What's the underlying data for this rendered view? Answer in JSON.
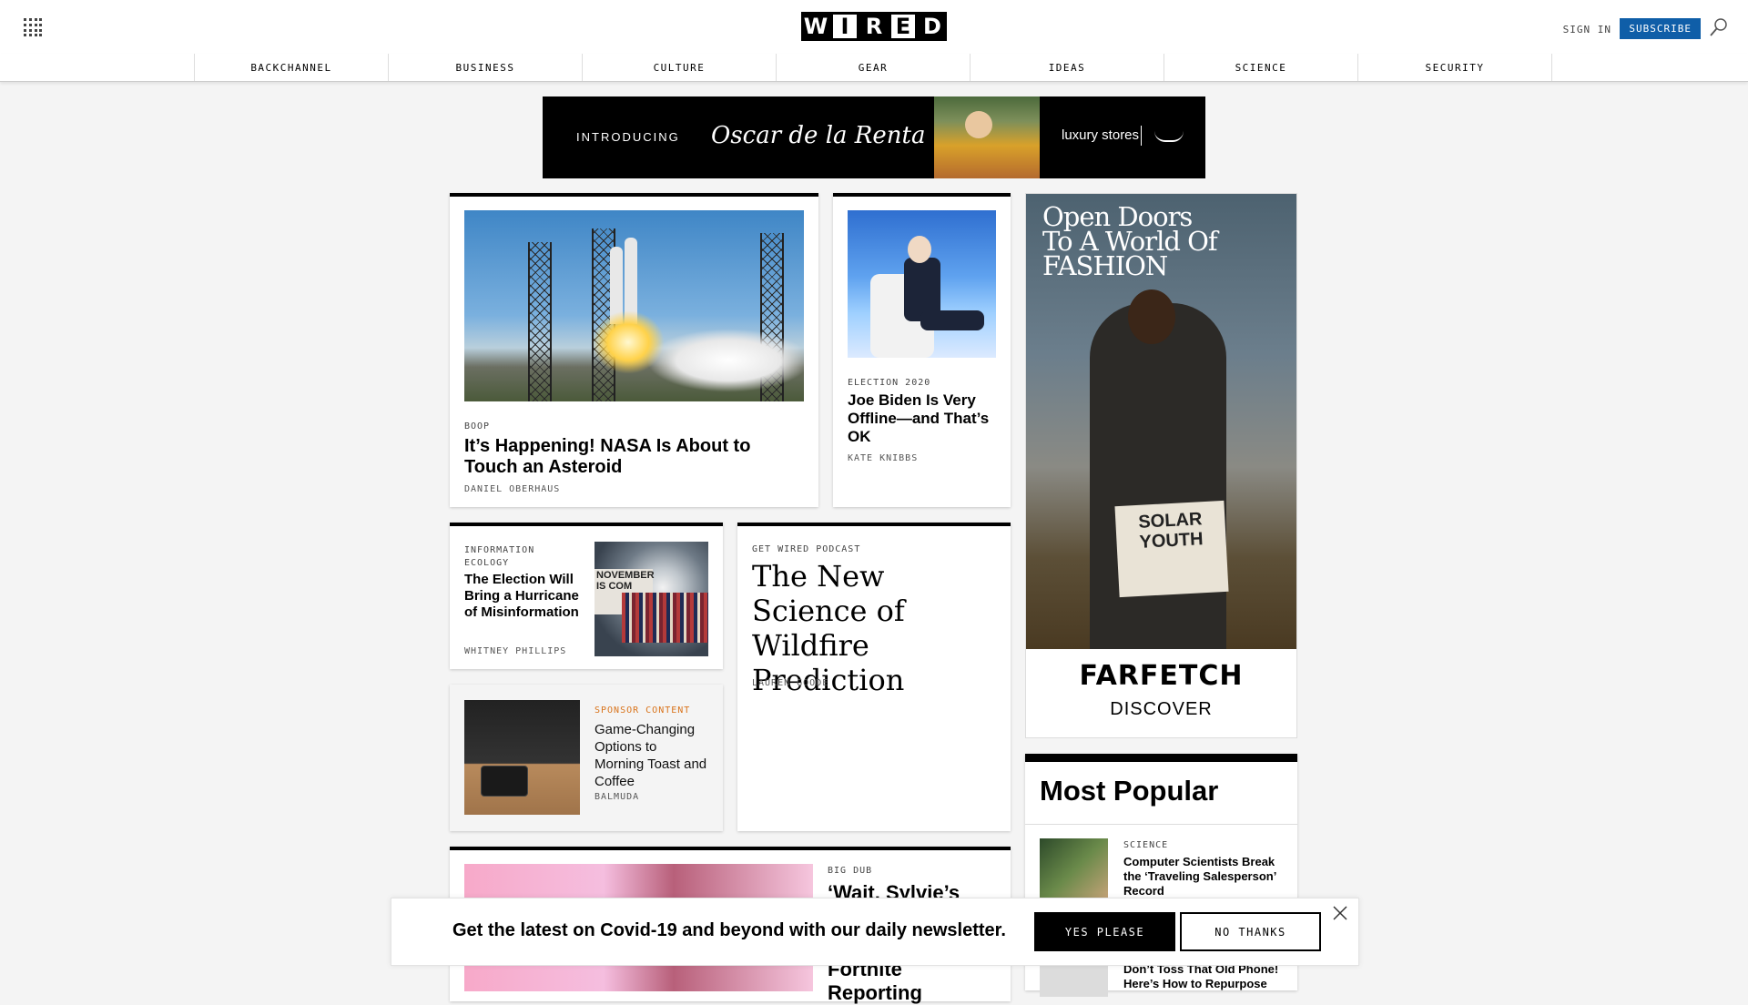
{
  "header": {
    "logo_letters": [
      "W",
      "I",
      "R",
      "E",
      "D"
    ],
    "sign_in": "SIGN IN",
    "subscribe": "SUBSCRIBE"
  },
  "nav": {
    "items": [
      "BACKCHANNEL",
      "BUSINESS",
      "CULTURE",
      "GEAR",
      "IDEAS",
      "SCIENCE",
      "SECURITY"
    ]
  },
  "ad_banner": {
    "intro": "INTRODUCING",
    "brand": "Oscar de la Renta",
    "store": "luxury stores"
  },
  "stories": {
    "nasa": {
      "kicker": "BOOP",
      "headline": "It’s Happening! NASA Is About to Touch an Asteroid",
      "byline": "DANIEL OBERHAUS"
    },
    "biden": {
      "kicker": "ELECTION 2020",
      "headline": "Joe Biden Is Very Offline—and That’s OK",
      "byline": "KATE KNIBBS"
    },
    "election": {
      "kicker": "INFORMATION ECOLOGY",
      "headline": "The Election Will Bring a Hurricane of Misinformation",
      "byline": "WHITNEY PHILLIPS",
      "sign_text": "NOVEMBER IS COM"
    },
    "wildfire": {
      "kicker": "GET WIRED PODCAST",
      "headline": "The New Science of Wildfire Prediction",
      "byline": "LAUREN GOODE"
    },
    "sponsor": {
      "kicker": "SPONSOR CONTENT",
      "headline": "Game-Changing Options to Morning Toast and Coffee",
      "byline": "BALMUDA"
    },
    "sylvie": {
      "kicker": "BIG DUB",
      "headline_partial": "‘Wait, Sylvie’s",
      "headline_partial_2": "Fortnite",
      "headline_partial_3": "Reporting"
    }
  },
  "side_ad": {
    "headline": "Open Doors To A World Of FASHION",
    "board_text": "SOLAR YOUTH",
    "brand": "FARFETCH",
    "cta": "DISCOVER"
  },
  "most_popular": {
    "title": "Most Popular",
    "items": [
      {
        "kicker": "SCIENCE",
        "headline": "Computer Scientists Break the ‘Traveling Salesperson’ Record"
      },
      {
        "kicker": "",
        "headline": "Don’t Toss That Old Phone! Here’s How to Repurpose"
      }
    ]
  },
  "newsletter": {
    "message": "Get the latest on Covid-19 and beyond with our daily newsletter.",
    "yes": "YES PLEASE",
    "no": "NO THANKS"
  },
  "colors": {
    "subscribe_bg": "#0f5ea8",
    "sponsor_kicker": "#d9731a"
  }
}
